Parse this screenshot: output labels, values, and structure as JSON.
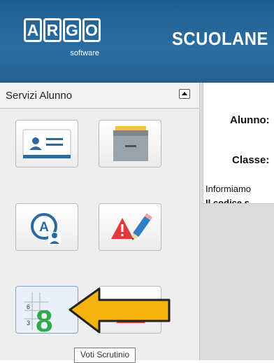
{
  "header": {
    "logo_letters": [
      "A",
      "R",
      "G",
      "O"
    ],
    "logo_subtitle": "software",
    "brand": "SCUOLANE"
  },
  "sidebar": {
    "title": "Servizi Alunno",
    "tiles": [
      {
        "icon": "student-id-card-icon"
      },
      {
        "icon": "file-drawer-icon"
      },
      {
        "icon": "absence-user-icon"
      },
      {
        "icon": "warning-pencil-icon"
      },
      {
        "icon": "grade-sheet-icon",
        "hovered": true
      },
      {
        "icon": "pie-chart-icon"
      }
    ],
    "tooltip": "Voti Scrutinio"
  },
  "main": {
    "student_label": "Alunno:",
    "class_label": "Classe:",
    "info_text": "Informiamo",
    "code_text": "Il codice s"
  },
  "colors": {
    "header_blue": "#2a6aa0",
    "arrow_fill": "#f6b30d",
    "grade_green": "#2faa4a"
  }
}
